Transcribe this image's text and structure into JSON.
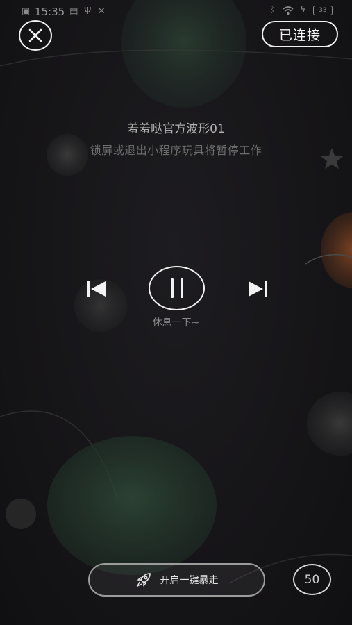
{
  "status_bar": {
    "time": "15:35",
    "battery": "33",
    "left_icons": [
      "sim-icon",
      "app-notification-icon",
      "usb-icon",
      "tools-icon"
    ],
    "right_icons": [
      "bluetooth-icon",
      "wifi-icon",
      "charging-icon",
      "battery-icon"
    ]
  },
  "header": {
    "close_icon": "close-icon",
    "connection_label": "已连接"
  },
  "mode": {
    "title": "羞羞哒官方波形01",
    "notice": "锁屏或退出小程序玩具将暂停工作"
  },
  "player": {
    "prev_icon": "skip-previous-icon",
    "pause_icon": "pause-icon",
    "next_icon": "skip-next-icon",
    "status_text": "休息一下~"
  },
  "footer": {
    "boost_icon": "rocket-icon",
    "boost_label": "开启一键暴走",
    "level_value": "50"
  },
  "colors": {
    "background": "#161518",
    "foreground": "#f2f2f2",
    "muted_text": "#6e6e6e",
    "planet_green": "#2f4a38",
    "planet_orange": "#7a3f20"
  }
}
